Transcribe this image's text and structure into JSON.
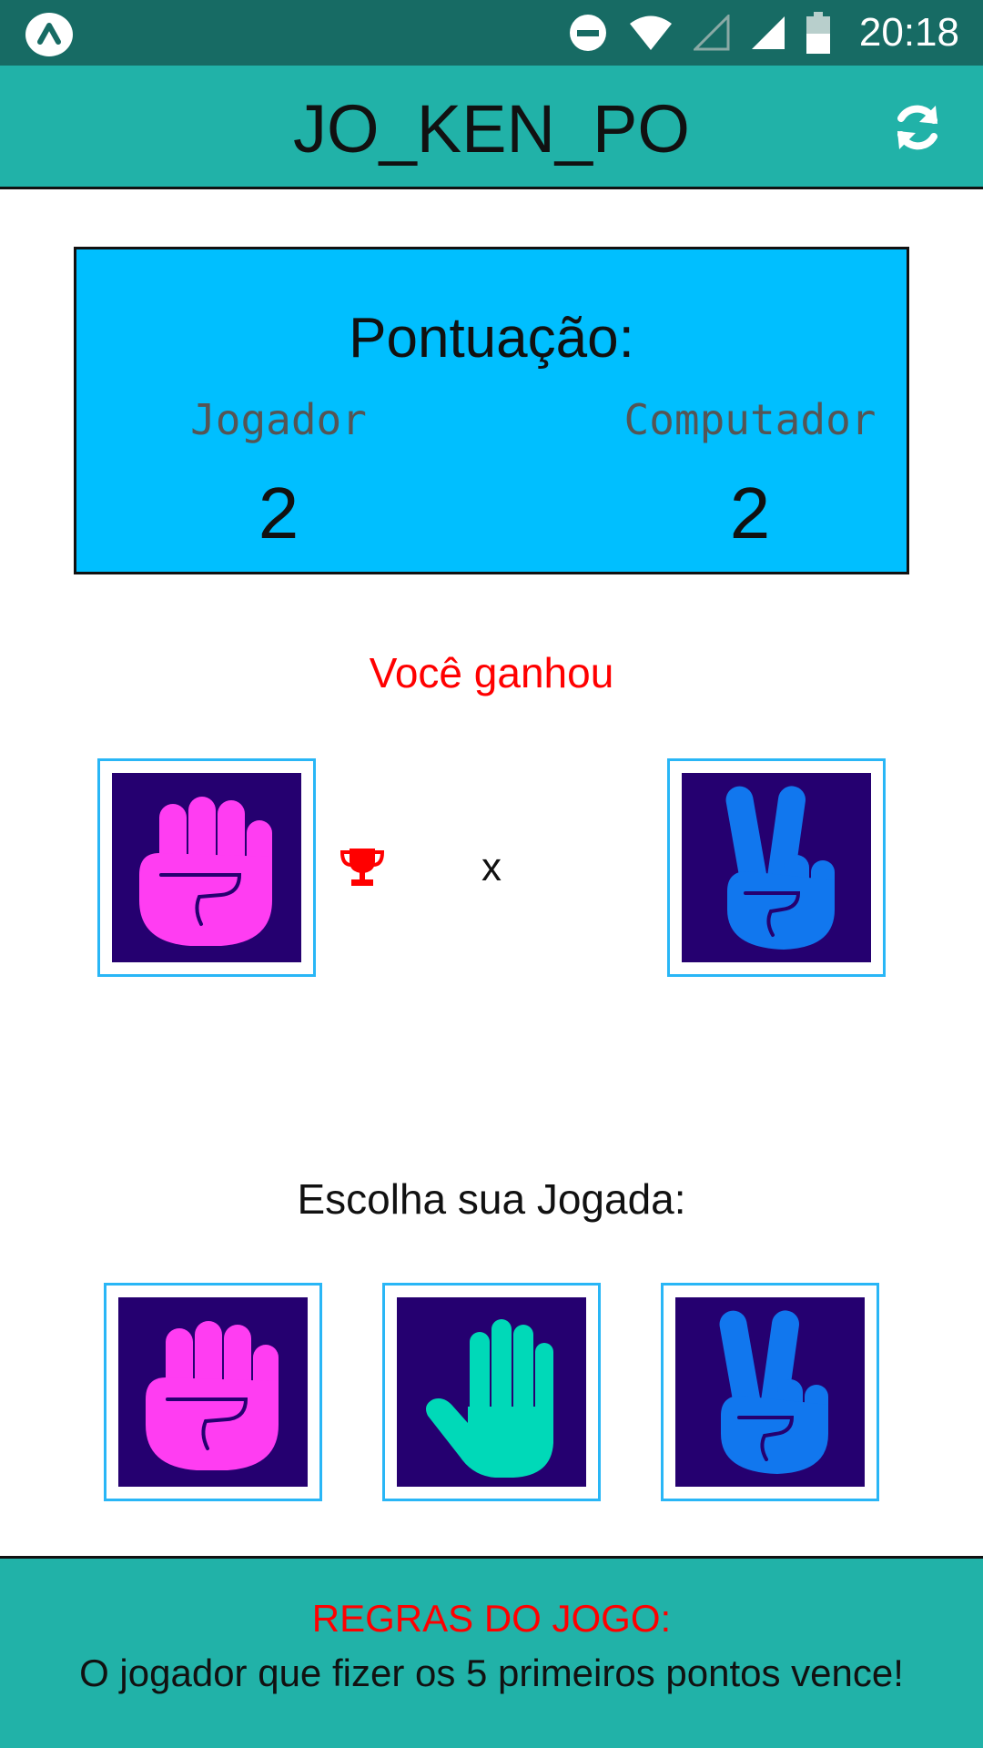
{
  "status_bar": {
    "time": "20:18",
    "icons": [
      "app-logo-icon",
      "do-not-disturb-icon",
      "wifi-icon",
      "signal-empty-icon",
      "signal-full-icon",
      "battery-icon"
    ],
    "color": "#176b64"
  },
  "app_bar": {
    "title": "JO_KEN_PO",
    "refresh_icon": "refresh-icon",
    "color": "#21b2a8"
  },
  "score": {
    "title": "Pontuação:",
    "player_label": "Jogador",
    "player_value": "2",
    "computer_label": "Computador",
    "computer_value": "2",
    "color": "#00bfff"
  },
  "result": {
    "text": "Você ganhou",
    "player_move": "rock",
    "computer_move": "scissors",
    "winner_icon": "trophy-icon",
    "vs": "x",
    "color": "#ff0000"
  },
  "choices": {
    "title": "Escolha sua Jogada:",
    "options": [
      "rock",
      "paper",
      "scissors"
    ]
  },
  "footer": {
    "rules_title": "REGRAS DO JOGO:",
    "rules_text": "O jogador que fizer os 5 primeiros pontos vence!"
  },
  "colors": {
    "rock": "#ff3df2",
    "paper": "#00d9b8",
    "scissors": "#1177ee",
    "hand_bg": "#250070"
  }
}
